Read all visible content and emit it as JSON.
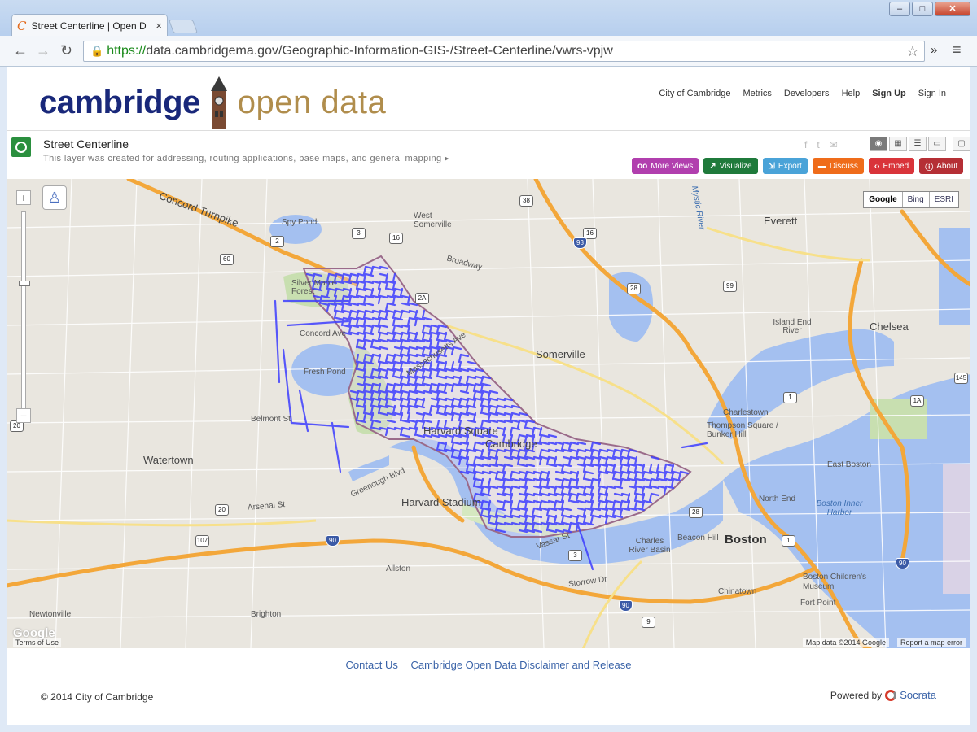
{
  "browser": {
    "tab_title": "Street Centerline | Open D",
    "tab_close": "×",
    "url_https": "https://",
    "url_rest": "data.cambridgema.gov/Geographic-Information-GIS-/Street-Centerline/vwrs-vpjw",
    "window_buttons": [
      "–",
      "□",
      "✕"
    ]
  },
  "site": {
    "logo_word1": "cambridge",
    "logo_word2": "open data",
    "nav": [
      "City of Cambridge",
      "Metrics",
      "Developers",
      "Help",
      "Sign Up",
      "Sign In"
    ]
  },
  "dataset": {
    "name": "Street Centerline",
    "description": "This layer was created for addressing, routing applications, base maps, and general mapping",
    "actions": [
      {
        "label": "More Views",
        "icon": "glasses-icon",
        "color": "#b13fae"
      },
      {
        "label": "Visualize",
        "icon": "chart-icon",
        "color": "#1f7a3b"
      },
      {
        "label": "Export",
        "icon": "export-icon",
        "color": "#4aa3d8"
      },
      {
        "label": "Discuss",
        "icon": "speech-bubble-icon",
        "color": "#ef6c1a"
      },
      {
        "label": "Embed",
        "icon": "code-icon",
        "color": "#d9343a"
      },
      {
        "label": "About",
        "icon": "info-icon",
        "color": "#b52f35"
      }
    ]
  },
  "map": {
    "providers": [
      "Google",
      "Bing",
      "ESRI"
    ],
    "google_mark": "Google",
    "terms": "Terms of Use",
    "map_data": "Map data ©2014 Google",
    "report": "Report a map error",
    "line_color": "#3d3dff",
    "labels": {
      "concord_turnpike": "Concord Turnpike",
      "spy_pond": "Spy Pond",
      "silver_maple": "Silver Maple Forest",
      "fresh_pond": "Fresh Pond",
      "harvard_square": "Harvard Square",
      "cambridge": "Cambridge",
      "watertown": "Watertown",
      "harvard_stadium": "Harvard Stadium",
      "somerville": "Somerville",
      "west_somerville": "West Somerville",
      "everett": "Everett",
      "chelsea": "Chelsea",
      "charlestown": "Charlestown",
      "bunker_hill": "Thompson Square / Bunker Hill",
      "boston": "Boston",
      "east_boston": "East Boston",
      "north_end": "North End",
      "beacon_hill": "Beacon Hill",
      "charles_basin": "Charles River Basin",
      "boston_harbor": "Boston Inner Harbor",
      "brighton": "Brighton",
      "allston": "Allston",
      "newtonville": "Newtonville",
      "chinatown": "Chinatown",
      "fort_point": "Fort Point",
      "childrens_museum": "Boston Children's Museum",
      "island_end": "Island End River",
      "storrow": "Storrow Dr",
      "mass_ave": "Massachusetts Ave",
      "broadway": "Broadway",
      "concord_ave": "Concord Ave",
      "belmont_st": "Belmont St",
      "arsenal_st": "Arsenal St",
      "mystic": "Mystic River",
      "greenough": "Greenough Blvd",
      "vassar": "Vassar St"
    },
    "shields": {
      "s2": "2",
      "s3": "3",
      "s16a": "16",
      "s16b": "16",
      "s60": "60",
      "s2a": "2A",
      "s28": "28",
      "s28b": "28",
      "s93": "93",
      "s99": "99",
      "s1": "1",
      "s1b": "1",
      "s1a": "1A",
      "s145": "145",
      "s20": "20",
      "s20b": "20",
      "s90a": "90",
      "s90b": "90",
      "s90c": "90",
      "s38": "38",
      "s3b": "3",
      "s9": "9",
      "s107": "107"
    }
  },
  "footer": {
    "links": [
      "Contact Us",
      "Cambridge Open Data Disclaimer and Release"
    ],
    "copyright": "© 2014 City of Cambridge",
    "powered_by": "Powered by",
    "socrata": "Socrata"
  }
}
